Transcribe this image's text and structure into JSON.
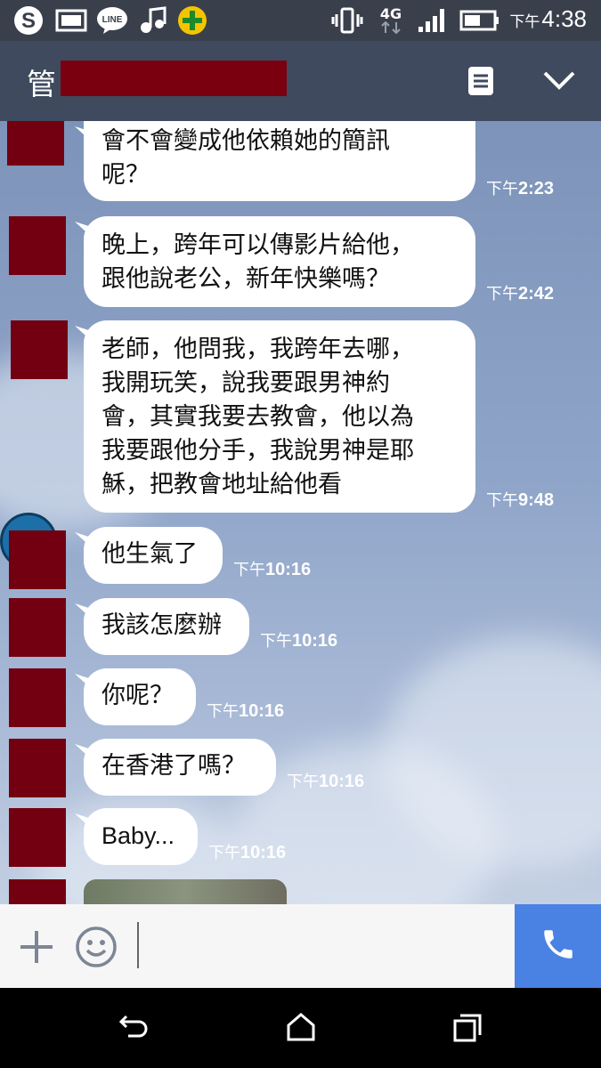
{
  "status_bar": {
    "time_prefix": "下午",
    "time": "4:38",
    "network": "4G",
    "left_icons": [
      "skype-icon",
      "gallery-icon",
      "line-icon",
      "music-icon",
      "app-icon"
    ],
    "right_icons": [
      "vibrate-icon",
      "network-4g-icon",
      "signal-icon",
      "battery-icon"
    ]
  },
  "header": {
    "title_visible_char": "管",
    "title_redacted": true,
    "menu_icon": "notes-icon",
    "collapse_icon": "chevron-down-icon"
  },
  "messages": [
    {
      "text": "會不會變成他依賴她的簡訊\n呢？",
      "time_prefix": "下午",
      "time": "2:23"
    },
    {
      "text": "晚上，跨年可以傳影片給他，\n跟他說老公，新年快樂嗎？",
      "time_prefix": "下午",
      "time": "2:42"
    },
    {
      "text": "老師，他問我，我跨年去哪，\n我開玩笑，說我要跟男神約\n會，其實我要去教會，他以為\n我要跟他分手，我說男神是耶\n穌，把教會地址給他看",
      "time_prefix": "下午",
      "time": "9:48"
    },
    {
      "text": "他生氣了",
      "time_prefix": "下午",
      "time": "10:16"
    },
    {
      "text": "我該怎麼辦",
      "time_prefix": "下午",
      "time": "10:16"
    },
    {
      "text": "你呢？",
      "time_prefix": "下午",
      "time": "10:16"
    },
    {
      "text": "在香港了嗎？",
      "time_prefix": "下午",
      "time": "10:16"
    },
    {
      "text": "Baby...",
      "time_prefix": "下午",
      "time": "10:16"
    }
  ],
  "input_bar": {
    "add_icon": "plus-icon",
    "emoji_icon": "emoji-icon",
    "call_icon": "phone-icon",
    "call_color": "#4a82e3"
  },
  "nav_bar": {
    "icons": [
      "back-icon",
      "home-icon",
      "recents-icon"
    ]
  },
  "colors": {
    "header_bg": "#3f4a5e",
    "redaction": "#730010",
    "bubble": "#ffffff"
  }
}
